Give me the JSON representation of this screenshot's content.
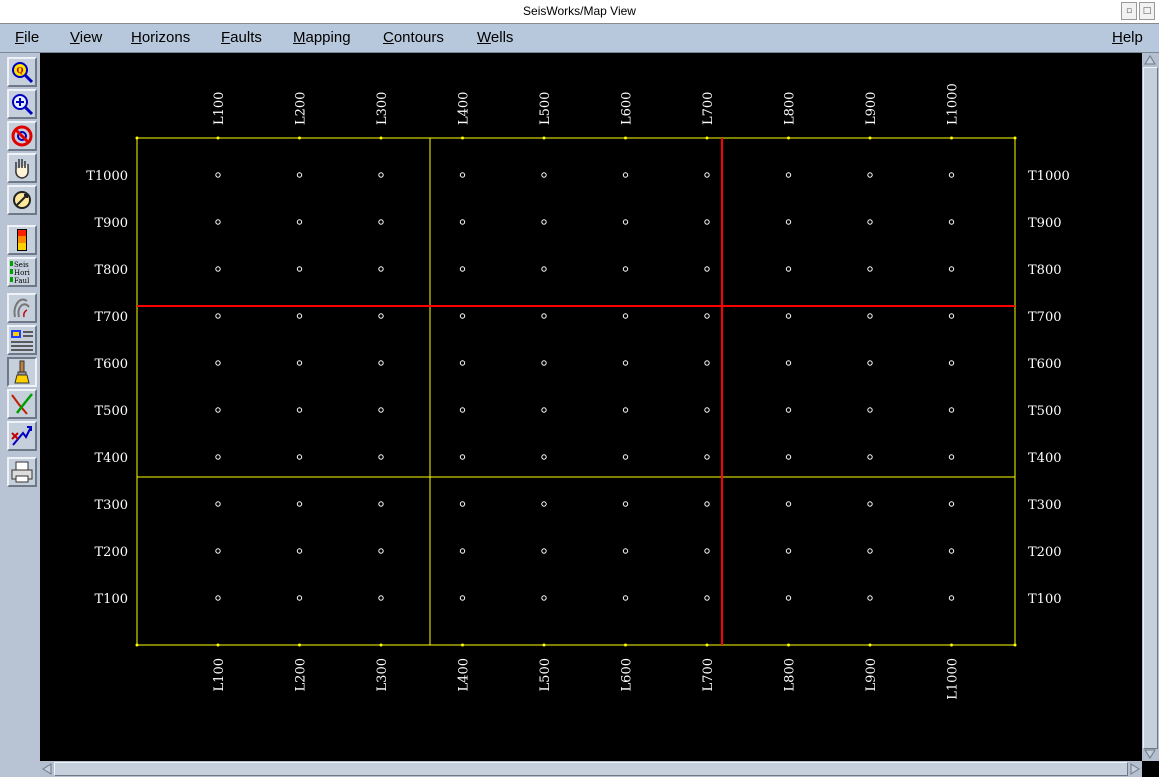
{
  "window": {
    "title": "SeisWorks/Map View"
  },
  "menubar": {
    "items": [
      "File",
      "View",
      "Horizons",
      "Faults",
      "Mapping",
      "Contours",
      "Wells"
    ],
    "help": "Help"
  },
  "toolbar": {
    "tools": [
      {
        "name": "zoom-area-icon",
        "pressed": false
      },
      {
        "name": "zoom-in-icon",
        "pressed": false
      },
      {
        "name": "zoom-cancel-icon",
        "pressed": false
      },
      {
        "name": "pan-hand-icon",
        "pressed": false
      },
      {
        "name": "refresh-icon",
        "pressed": false
      },
      {
        "name": "color-bar-icon",
        "pressed": false
      },
      {
        "name": "seis-hori-faul-icon",
        "pressed": false,
        "text": [
          "Seis",
          "Hori",
          "Faul"
        ]
      },
      {
        "name": "fault-trace-icon",
        "pressed": false
      },
      {
        "name": "color-legend-icon",
        "pressed": false
      },
      {
        "name": "paint-brush-icon",
        "pressed": true
      },
      {
        "name": "line-draw-icon",
        "pressed": false
      },
      {
        "name": "pick-arrow-icon",
        "pressed": false
      },
      {
        "name": "print-icon",
        "pressed": false
      }
    ]
  },
  "map": {
    "lines": [
      "L100",
      "L200",
      "L300",
      "L400",
      "L500",
      "L600",
      "L700",
      "L800",
      "L900",
      "L1000"
    ],
    "traces": [
      "T1000",
      "T900",
      "T800",
      "T700",
      "T600",
      "T500",
      "T400",
      "T300",
      "T200",
      "T100"
    ],
    "colors": {
      "background": "#000000",
      "boundary": "#ffff00",
      "selected": "#ff0000",
      "label": "#ffffff",
      "shotpoint": "#ffffff"
    }
  }
}
